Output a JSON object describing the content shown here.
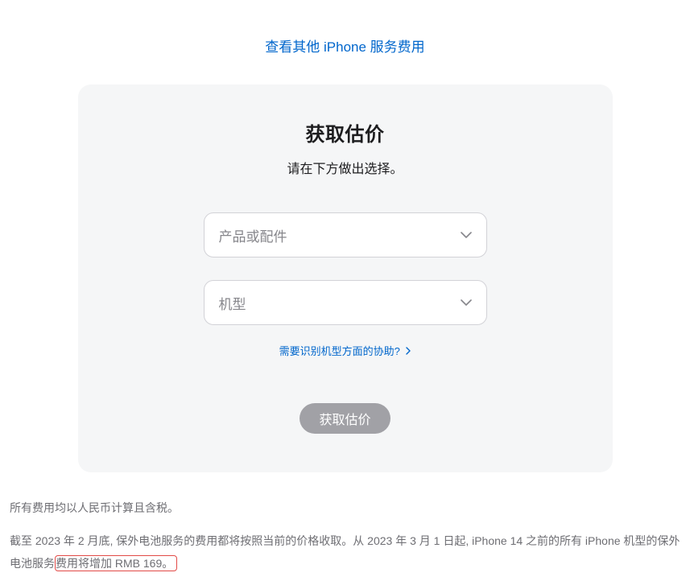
{
  "topLink": {
    "label": "查看其他 iPhone 服务费用"
  },
  "card": {
    "title": "获取估价",
    "subtitle": "请在下方做出选择。",
    "select1": {
      "placeholder": "产品或配件"
    },
    "select2": {
      "placeholder": "机型"
    },
    "helpLink": {
      "label": "需要识别机型方面的协助?"
    },
    "button": {
      "label": "获取估价"
    }
  },
  "notes": {
    "line1": "所有费用均以人民币计算且含税。",
    "line2_a": "截至 2023 年 2 月底, 保外电池服务的费用都将按照当前的价格收取。从 2023 年 3 月 1 日起, iPhone 14 之前的所有 iPhone 机型的保外电池服务",
    "line2_b": "费用将增加 RMB 169。"
  }
}
